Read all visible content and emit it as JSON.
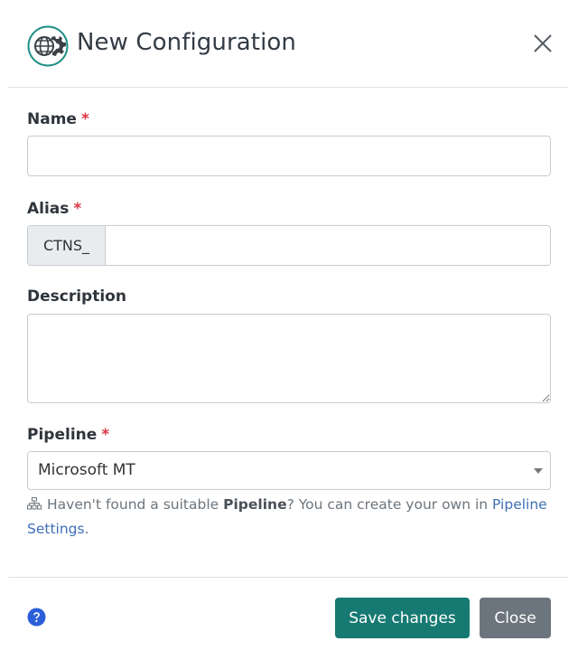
{
  "modal": {
    "title": "New Configuration",
    "logo_icon": "globe-gear-icon",
    "close_icon": "close-icon"
  },
  "form": {
    "name": {
      "label": "Name",
      "required_mark": "*",
      "value": ""
    },
    "alias": {
      "label": "Alias",
      "required_mark": "*",
      "prefix": "CTNS_",
      "value": ""
    },
    "description": {
      "label": "Description",
      "value": ""
    },
    "pipeline": {
      "label": "Pipeline",
      "required_mark": "*",
      "selected": "Microsoft MT",
      "hint_prefix": "Haven't found a suitable ",
      "hint_bold": "Pipeline",
      "hint_mid": "? You can create your own in ",
      "hint_link": "Pipeline Settings",
      "hint_end": "."
    }
  },
  "footer": {
    "help_icon": "question-circle-icon",
    "save_label": "Save changes",
    "close_label": "Close"
  },
  "colors": {
    "primary": "#167a72",
    "secondary": "#6c757d",
    "required": "#dc3545",
    "link": "#3d6fb6",
    "help": "#2b5fd9"
  }
}
